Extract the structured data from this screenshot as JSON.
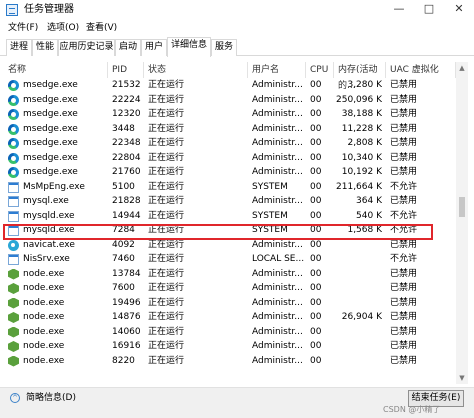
{
  "window": {
    "title": "任务管理器",
    "controls": {
      "minimize": "—",
      "maximize": "□",
      "close": "✕"
    }
  },
  "menu": [
    "文件(F)",
    "选项(O)",
    "查看(V)"
  ],
  "tabs": [
    {
      "label": "进程"
    },
    {
      "label": "性能"
    },
    {
      "label": "应用历史记录"
    },
    {
      "label": "启动"
    },
    {
      "label": "用户"
    },
    {
      "label": "详细信息",
      "active": true
    },
    {
      "label": "服务"
    }
  ],
  "table": {
    "columns": [
      "名称",
      "PID",
      "状态",
      "用户名",
      "CPU",
      "内存(活动的...",
      "UAC 虚拟化"
    ],
    "rows": [
      {
        "icon": "edge",
        "name": "msedge.exe",
        "pid": "21532",
        "status": "正在运行",
        "user": "Administr...",
        "cpu": "00",
        "mem": "3,280 K",
        "uac": "已禁用"
      },
      {
        "icon": "edge",
        "name": "msedge.exe",
        "pid": "22224",
        "status": "正在运行",
        "user": "Administr...",
        "cpu": "00",
        "mem": "250,096 K",
        "uac": "已禁用"
      },
      {
        "icon": "edge",
        "name": "msedge.exe",
        "pid": "12320",
        "status": "正在运行",
        "user": "Administr...",
        "cpu": "00",
        "mem": "38,188 K",
        "uac": "已禁用"
      },
      {
        "icon": "edge",
        "name": "msedge.exe",
        "pid": "3448",
        "status": "正在运行",
        "user": "Administr...",
        "cpu": "00",
        "mem": "11,228 K",
        "uac": "已禁用"
      },
      {
        "icon": "edge",
        "name": "msedge.exe",
        "pid": "22348",
        "status": "正在运行",
        "user": "Administr...",
        "cpu": "00",
        "mem": "2,808 K",
        "uac": "已禁用"
      },
      {
        "icon": "edge",
        "name": "msedge.exe",
        "pid": "22804",
        "status": "正在运行",
        "user": "Administr...",
        "cpu": "00",
        "mem": "10,340 K",
        "uac": "已禁用"
      },
      {
        "icon": "edge",
        "name": "msedge.exe",
        "pid": "21760",
        "status": "正在运行",
        "user": "Administr...",
        "cpu": "00",
        "mem": "10,192 K",
        "uac": "已禁用"
      },
      {
        "icon": "win",
        "name": "MsMpEng.exe",
        "pid": "5100",
        "status": "正在运行",
        "user": "SYSTEM",
        "cpu": "00",
        "mem": "211,664 K",
        "uac": "不允许"
      },
      {
        "icon": "win",
        "name": "mysql.exe",
        "pid": "21828",
        "status": "正在运行",
        "user": "Administr...",
        "cpu": "00",
        "mem": "364 K",
        "uac": "已禁用"
      },
      {
        "icon": "win",
        "name": "mysqld.exe",
        "pid": "14944",
        "status": "正在运行",
        "user": "SYSTEM",
        "cpu": "00",
        "mem": "540 K",
        "uac": "不允许"
      },
      {
        "icon": "win",
        "name": "mysqld.exe",
        "pid": "7284",
        "status": "正在运行",
        "user": "SYSTEM",
        "cpu": "00",
        "mem": "1,568 K",
        "uac": "不允许",
        "highlighted": true
      },
      {
        "icon": "navicat",
        "name": "navicat.exe",
        "pid": "4092",
        "status": "正在运行",
        "user": "Administr...",
        "cpu": "00",
        "mem": "",
        "uac": "已禁用"
      },
      {
        "icon": "win",
        "name": "NisSrv.exe",
        "pid": "7460",
        "status": "正在运行",
        "user": "LOCAL SE...",
        "cpu": "00",
        "mem": "",
        "uac": "不允许"
      },
      {
        "icon": "node",
        "name": "node.exe",
        "pid": "13784",
        "status": "正在运行",
        "user": "Administr...",
        "cpu": "00",
        "mem": "",
        "uac": "已禁用"
      },
      {
        "icon": "node",
        "name": "node.exe",
        "pid": "7600",
        "status": "正在运行",
        "user": "Administr...",
        "cpu": "00",
        "mem": "",
        "uac": "已禁用"
      },
      {
        "icon": "node",
        "name": "node.exe",
        "pid": "19496",
        "status": "正在运行",
        "user": "Administr...",
        "cpu": "00",
        "mem": "",
        "uac": "已禁用"
      },
      {
        "icon": "node",
        "name": "node.exe",
        "pid": "14876",
        "status": "正在运行",
        "user": "Administr...",
        "cpu": "00",
        "mem": "26,904 K",
        "uac": "已禁用"
      },
      {
        "icon": "node",
        "name": "node.exe",
        "pid": "14060",
        "status": "正在运行",
        "user": "Administr...",
        "cpu": "00",
        "mem": "",
        "uac": "已禁用"
      },
      {
        "icon": "node",
        "name": "node.exe",
        "pid": "16916",
        "status": "正在运行",
        "user": "Administr...",
        "cpu": "00",
        "mem": "",
        "uac": "已禁用"
      },
      {
        "icon": "node",
        "name": "node.exe",
        "pid": "8220",
        "status": "正在运行",
        "user": "Administr...",
        "cpu": "00",
        "mem": "",
        "uac": "已禁用"
      }
    ]
  },
  "footer": {
    "brief_label": "简略信息(D)",
    "end_task_label": "结束任务(E)",
    "watermark": "CSDN @小精了"
  }
}
